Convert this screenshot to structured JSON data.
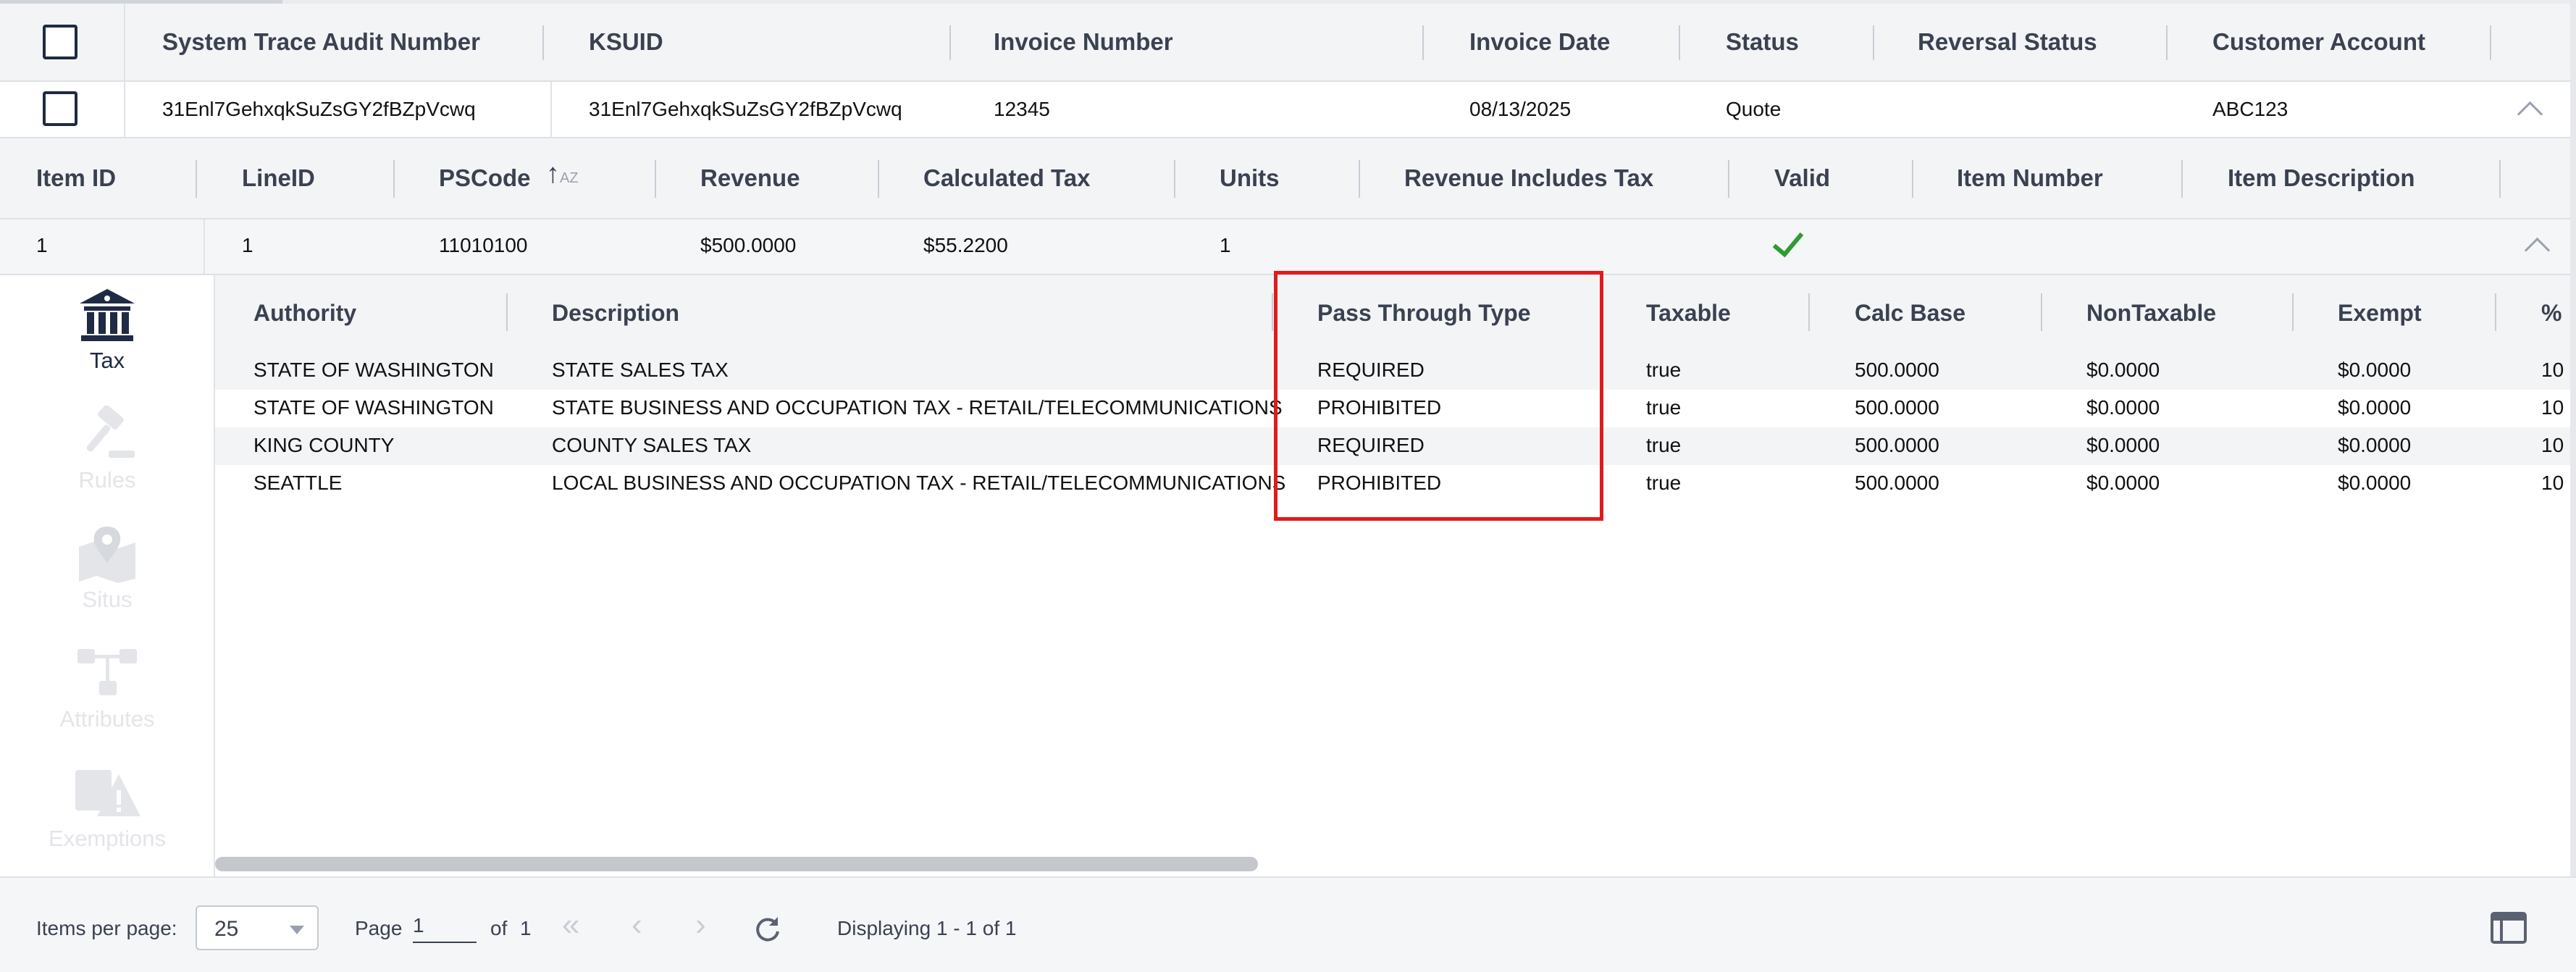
{
  "invoice_grid": {
    "headers": [
      "System Trace Audit Number",
      "KSUID",
      "Invoice Number",
      "Invoice Date",
      "Status",
      "Reversal Status",
      "Customer Account"
    ],
    "row": {
      "system_trace_audit_number": "31Enl7GehxqkSuZsGY2fBZpVcwq",
      "ksuid": "31Enl7GehxqkSuZsGY2fBZpVcwq",
      "invoice_number": "12345",
      "invoice_date": "08/13/2025",
      "status": "Quote",
      "reversal_status": "",
      "customer_account": "ABC123"
    }
  },
  "item_grid": {
    "headers": [
      "Item ID",
      "LineID",
      "PSCode",
      "Revenue",
      "Calculated Tax",
      "Units",
      "Revenue Includes Tax",
      "Valid",
      "Item Number",
      "Item Description"
    ],
    "row": {
      "item_id": "1",
      "line_id": "1",
      "ps_code": "11010100",
      "revenue": "$500.0000",
      "calculated_tax": "$55.2200",
      "units": "1",
      "revenue_includes_tax": "",
      "valid": true,
      "item_number": "",
      "item_description": ""
    }
  },
  "side_tabs": [
    {
      "label": "Tax",
      "icon": "bank-icon",
      "active": true
    },
    {
      "label": "Rules",
      "icon": "gavel-icon",
      "active": false
    },
    {
      "label": "Situs",
      "icon": "map-pin-icon",
      "active": false
    },
    {
      "label": "Attributes",
      "icon": "hierarchy-icon",
      "active": false
    },
    {
      "label": "Exemptions",
      "icon": "warning-icon",
      "active": false
    }
  ],
  "tax_table": {
    "headers": [
      "Authority",
      "Description",
      "Pass Through Type",
      "Taxable",
      "Calc Base",
      "NonTaxable",
      "Exempt",
      "%"
    ],
    "rows": [
      {
        "authority": "STATE OF WASHINGTON",
        "description": "STATE SALES TAX",
        "pass_through_type": "REQUIRED",
        "taxable": "true",
        "calc_base": "500.0000",
        "non_taxable": "$0.0000",
        "exempt": "$0.0000",
        "percent": "10"
      },
      {
        "authority": "STATE OF WASHINGTON",
        "description": "STATE BUSINESS AND OCCUPATION TAX - RETAIL/TELECOMMUNICATIONS",
        "pass_through_type": "PROHIBITED",
        "taxable": "true",
        "calc_base": "500.0000",
        "non_taxable": "$0.0000",
        "exempt": "$0.0000",
        "percent": "10"
      },
      {
        "authority": "KING COUNTY",
        "description": "COUNTY SALES TAX",
        "pass_through_type": "REQUIRED",
        "taxable": "true",
        "calc_base": "500.0000",
        "non_taxable": "$0.0000",
        "exempt": "$0.0000",
        "percent": "10"
      },
      {
        "authority": "SEATTLE",
        "description": "LOCAL BUSINESS AND OCCUPATION TAX - RETAIL/TELECOMMUNICATIONS",
        "pass_through_type": "PROHIBITED",
        "taxable": "true",
        "calc_base": "500.0000",
        "non_taxable": "$0.0000",
        "exempt": "$0.0000",
        "percent": "10"
      }
    ]
  },
  "footer": {
    "items_per_page_label": "Items per page:",
    "items_per_page_value": "25",
    "page_label": "Page",
    "page_value": "1",
    "of_label": "of",
    "total_pages": "1",
    "displaying": "Displaying 1 - 1 of 1"
  },
  "colors": {
    "highlight": "#e01b1b",
    "valid_check": "#2e9d2e",
    "header_bg": "#f3f4f6",
    "active_tab": "#1f2a44",
    "inactive_tab": "#e3e5e9"
  }
}
